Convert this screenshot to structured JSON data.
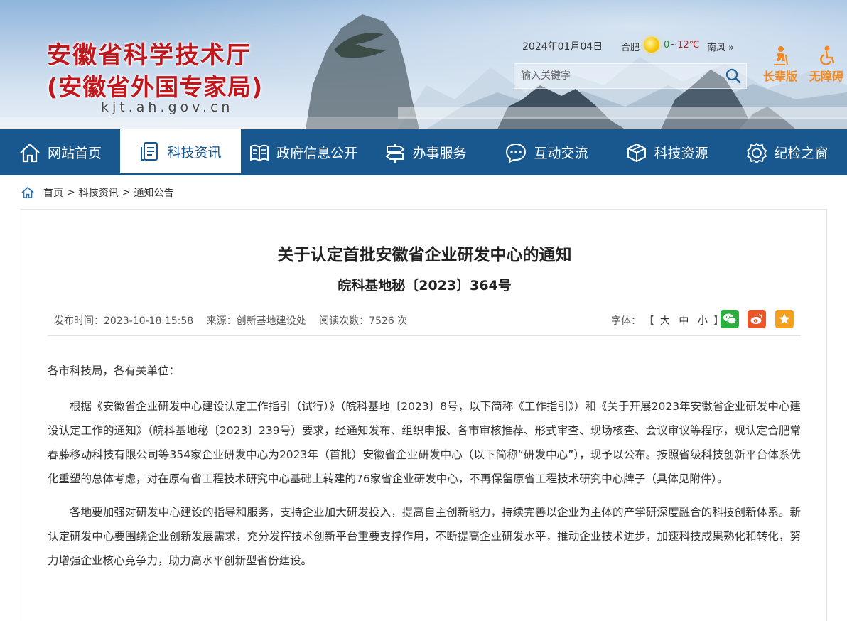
{
  "header": {
    "title": "安徽省科学技术厅",
    "subtitle": "(安徽省外国专家局)",
    "domain": "kjt.ah.gov.cn",
    "date": "2024年01月04日",
    "weather": {
      "city": "合肥",
      "temp_low": "0",
      "temp_sep": "~",
      "temp_high": "12℃",
      "wind": "南风 »",
      "icon": "sun-icon"
    },
    "search": {
      "placeholder": "输入关键字",
      "icon": "search-icon"
    },
    "tools": {
      "elder": "长辈版",
      "access": "无障碍"
    }
  },
  "nav": {
    "items": [
      {
        "label": "网站首页",
        "icon": "home-icon"
      },
      {
        "label": "科技资讯",
        "icon": "document-icon",
        "active": true
      },
      {
        "label": "政府信息公开",
        "icon": "book-icon"
      },
      {
        "label": "办事服务",
        "icon": "signpost-icon"
      },
      {
        "label": "互动交流",
        "icon": "chat-icon"
      },
      {
        "label": "科技资源",
        "icon": "box-icon"
      },
      {
        "label": "纪检之窗",
        "icon": "badge-icon"
      }
    ]
  },
  "breadcrumb": {
    "home": "首页",
    "sep": ">",
    "level1": "科技资讯",
    "level2": "通知公告"
  },
  "article": {
    "title": "关于认定首批安徽省企业研发中心的通知",
    "doc_number": "皖科基地秘〔2023〕364号",
    "meta": {
      "publish": "发布时间：2023-10-18 15:58",
      "source": "来源：创新基地建设处",
      "views": "阅读次数：7526 次"
    },
    "font_size": {
      "label": "字体：",
      "open": "【",
      "large": "大",
      "medium": "中",
      "small": "小",
      "close": "】"
    },
    "share": {
      "wechat": "wechat-icon",
      "weibo": "weibo-icon",
      "favorite": "star-icon"
    },
    "salutation": "各市科技局，各有关单位：",
    "paragraphs": [
      "根据《安徽省企业研发中心建设认定工作指引（试行）》（皖科基地〔2023〕8号，以下简称《工作指引》）和《关于开展2023年安徽省企业研发中心建设认定工作的通知》（皖科基地秘〔2023〕239号）要求，经通知发布、组织申报、各市审核推荐、形式审查、现场核查、会议审议等程序，现认定合肥常春藤移动科技有限公司等354家企业研发中心为2023年（首批）安徽省企业研发中心（以下简称“研发中心”），现予以公布。按照省级科技创新平台体系优化重塑的总体考虑，对在原有省工程技术研究中心基础上转建的76家省企业研发中心，不再保留原省工程技术研究中心牌子（具体见附件）。",
      "各地要加强对研发中心建设的指导和服务，支持企业加大研发投入，提高自主创新能力，持续完善以企业为主体的产学研深度融合的科技创新体系。新认定研发中心要围绕企业创新发展需求，充分发挥技术创新平台重要支撑作用，不断提高企业研发水平，推动企业技术进步，加速科技成果熟化和转化，努力增强企业核心竞争力，助力高水平创新型省份建设。"
    ]
  },
  "colors": {
    "nav_bg": "#18588f",
    "title_red": "#c0161c",
    "tool_orange": "#f08a24"
  }
}
